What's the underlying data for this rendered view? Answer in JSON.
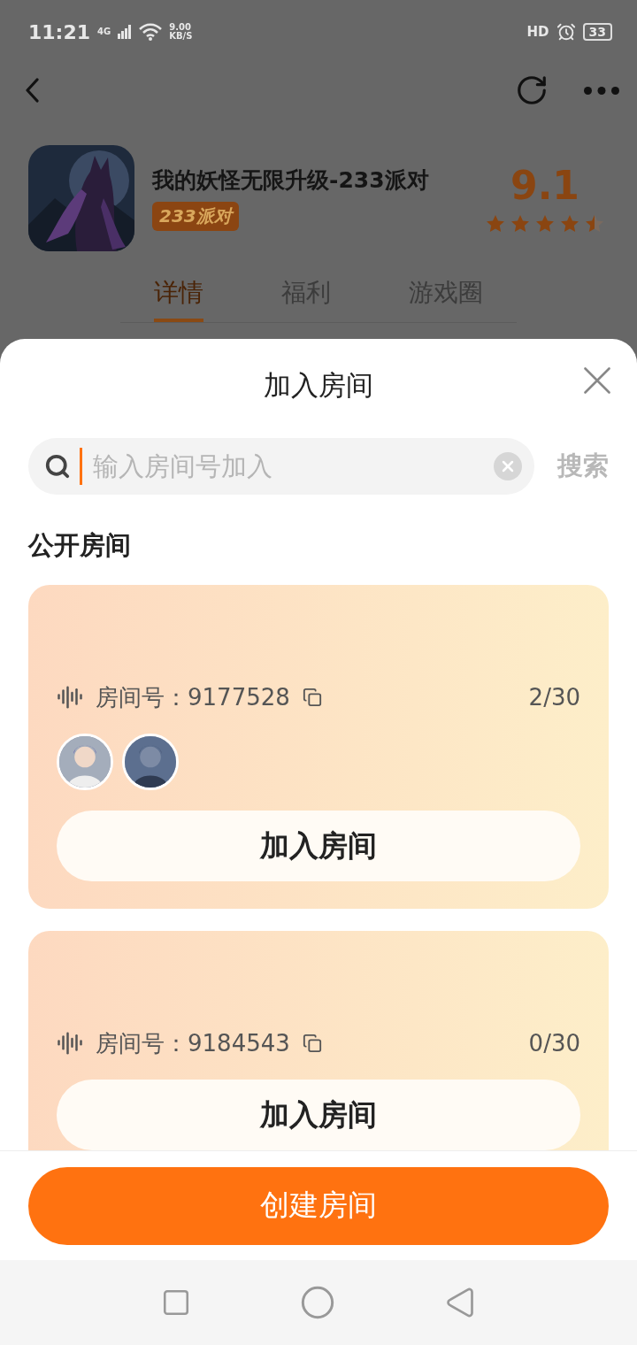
{
  "status_bar": {
    "time": "11:21",
    "network": "4G",
    "speed_value": "9.00",
    "speed_unit": "KB/S",
    "hd": "HD",
    "battery": "33"
  },
  "app": {
    "title": "我的妖怪无限升级-233派对",
    "badge": "233派对",
    "rating": "9.1",
    "stars": 4.5
  },
  "tabs": [
    {
      "label": "详情",
      "selected": true
    },
    {
      "label": "福利",
      "selected": false
    },
    {
      "label": "游戏圈",
      "selected": false
    }
  ],
  "sheet": {
    "title": "加入房间",
    "search": {
      "placeholder": "输入房间号加入",
      "button": "搜索"
    },
    "section_title": "公开房间",
    "rooms": [
      {
        "room_label": "房间号：9177528",
        "count": "2/30",
        "join_button": "加入房间"
      },
      {
        "room_label": "房间号：9184543",
        "count": "0/30",
        "join_button": "加入房间"
      }
    ],
    "create_button": "创建房间"
  }
}
